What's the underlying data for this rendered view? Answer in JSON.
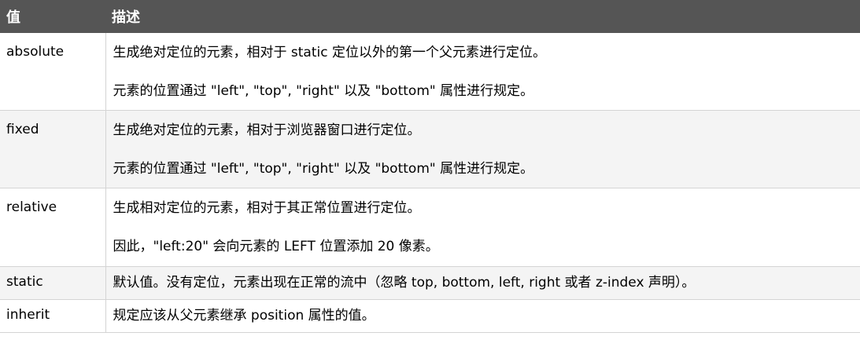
{
  "header": {
    "value_label": "值",
    "description_label": "描述"
  },
  "rows": [
    {
      "value": "absolute",
      "lines": [
        "生成绝对定位的元素，相对于 static 定位以外的第一个父元素进行定位。",
        "元素的位置通过 \"left\", \"top\", \"right\" 以及 \"bottom\" 属性进行规定。"
      ]
    },
    {
      "value": "fixed",
      "lines": [
        "生成绝对定位的元素，相对于浏览器窗口进行定位。",
        "元素的位置通过 \"left\", \"top\", \"right\" 以及 \"bottom\" 属性进行规定。"
      ]
    },
    {
      "value": "relative",
      "lines": [
        "生成相对定位的元素，相对于其正常位置进行定位。",
        "因此，\"left:20\" 会向元素的 LEFT 位置添加 20 像素。"
      ]
    },
    {
      "value": "static",
      "lines": [
        "默认值。没有定位，元素出现在正常的流中（忽略 top, bottom, left, right 或者 z-index 声明）。"
      ]
    },
    {
      "value": "inherit",
      "lines": [
        "规定应该从父元素继承 position 属性的值。"
      ]
    }
  ]
}
